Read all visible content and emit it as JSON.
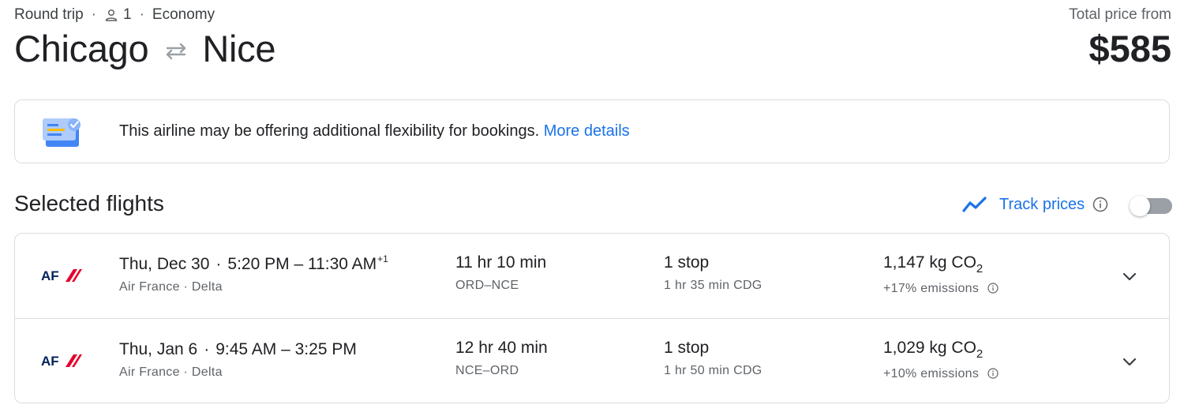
{
  "header": {
    "trip_type": "Round trip",
    "passengers": "1",
    "cabin": "Economy",
    "origin": "Chicago",
    "destination": "Nice",
    "price_label": "Total price from",
    "price": "$585"
  },
  "banner": {
    "message": "This airline may be offering additional flexibility for bookings.",
    "link": "More details"
  },
  "section": {
    "title": "Selected flights",
    "track_prices": "Track prices",
    "track_prices_enabled": false
  },
  "flights": [
    {
      "airline_logo": "AF",
      "date": "Thu, Dec 30",
      "times": "5:20 PM – 11:30 AM",
      "day_offset": "+1",
      "carriers": "Air France · Delta",
      "duration": "11 hr 10 min",
      "route": "ORD–NCE",
      "stops": "1 stop",
      "layover": "1 hr 35 min CDG",
      "co2_value": "1,147 kg CO",
      "co2_sub": "2",
      "emissions": "+17% emissions"
    },
    {
      "airline_logo": "AF",
      "date": "Thu, Jan 6",
      "times": "9:45 AM – 3:25 PM",
      "day_offset": "",
      "carriers": "Air France · Delta",
      "duration": "12 hr 40 min",
      "route": "NCE–ORD",
      "stops": "1 stop",
      "layover": "1 hr 50 min CDG",
      "co2_value": "1,029 kg CO",
      "co2_sub": "2",
      "emissions": "+10% emissions"
    }
  ],
  "colors": {
    "accent": "#1a73e8",
    "air_france_red": "#e4002b",
    "air_france_navy": "#002157"
  }
}
